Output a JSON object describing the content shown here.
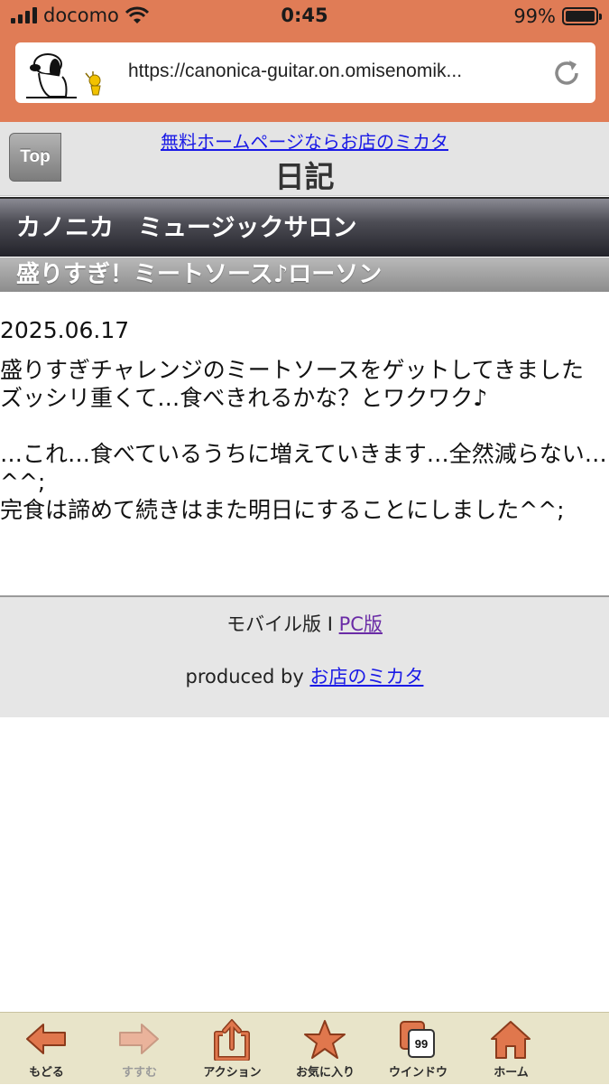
{
  "status_bar": {
    "carrier": "docomo",
    "time": "0:45",
    "battery_pct": "99%",
    "battery_level": 0.99
  },
  "browser": {
    "url": "https://canonica-guitar.on.omisenomik..."
  },
  "header": {
    "top_label": "Top",
    "promo_link": "無料ホームページならお店のミカタ",
    "title": "日記"
  },
  "shop_name": "カノニカ　ミュージックサロン",
  "article": {
    "title": "盛りすぎ！ミートソース♪ローソン",
    "date": "2025.06.17",
    "paragraphs": [
      [
        "盛りすぎチャレンジのミートソースをゲットしてきました",
        "ズッシリ重くて…食べきれるかな？とワクワク♪"
      ],
      [
        "…これ…食べているうちに増えていきます…全然減らない…^^;",
        "完食は諦めて続きはまた明日にすることにしました^^;"
      ]
    ]
  },
  "footer": {
    "mobile_label": "モバイル版 I ",
    "pc_link": "PC版",
    "produced_by": "produced by ",
    "produced_link": "お店のミカタ"
  },
  "toolbar": {
    "items": [
      {
        "label": "もどる",
        "icon": "back-arrow-icon",
        "enabled": true
      },
      {
        "label": "すすむ",
        "icon": "forward-arrow-icon",
        "enabled": false
      },
      {
        "label": "アクション",
        "icon": "share-icon",
        "enabled": true
      },
      {
        "label": "お気に入り",
        "icon": "star-icon",
        "enabled": true
      },
      {
        "label": "ウインドウ",
        "icon": "windows-icon",
        "enabled": true,
        "badge": "99"
      },
      {
        "label": "ホーム",
        "icon": "home-icon",
        "enabled": true
      }
    ]
  },
  "colors": {
    "browser_accent": "#e07c56",
    "icon_orange": "#e0774d",
    "link_blue": "#1a1ae6"
  }
}
